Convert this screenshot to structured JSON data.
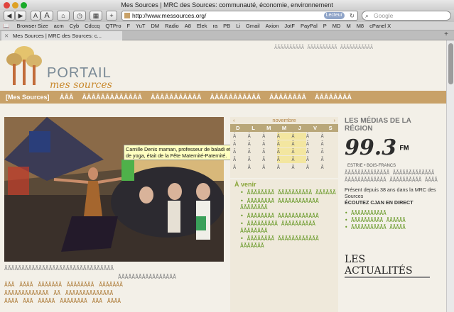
{
  "window": {
    "title": "Mes Sources | MRC des Sources: communauté, économie, environnement"
  },
  "toolbar": {
    "url": "http://www.messources.org/",
    "reader": "Lecteur",
    "search_placeholder": "Google",
    "font_small": "A",
    "font_large": "A"
  },
  "bookmarks": [
    "Browser Size",
    "acm",
    "Cyb",
    "Cdccq",
    "QTPro",
    "F",
    "YuT",
    "DM",
    "Radio",
    "A8",
    "Elek",
    "ra",
    "PB",
    "Li",
    "Gmail",
    "Axion",
    "JotF",
    "PayPal",
    "P",
    "MD",
    "M",
    "M8",
    "cPanel X"
  ],
  "tab": {
    "label": "Mes Sources | MRC des Sources: c..."
  },
  "site": {
    "logo_line1": "PORTAIL",
    "logo_line2": "mes sources",
    "nav_first": "[Mes Sources]",
    "nav_items": [
      "ĀĀĀ",
      "ĀĀĀĀĀĀĀĀĀĀĀĀĀ",
      "ĀĀĀĀĀĀĀĀĀĀĀ",
      "ĀĀĀĀĀĀĀĀĀĀĀ",
      "ĀĀĀĀĀĀĀĀ",
      "ĀĀĀĀĀĀĀĀ"
    ],
    "top_links": "ĀĀĀĀĀĀĀĀĀĀ  ĀĀĀĀĀĀĀĀĀĀ  ĀĀĀĀĀĀĀĀĀĀĀ",
    "photo_caption": "Camille Denis maman, professeur de baladi et de yoga, était de la Fête Maternité-Paternité.",
    "calendar": {
      "month": "novembre",
      "prev": "‹",
      "next": "›",
      "days": [
        "D",
        "L",
        "M",
        "M",
        "J",
        "V",
        "S"
      ]
    },
    "avenir_title": "À venir",
    "right_title": "LES MÉDIAS DE LA RÉGION",
    "radio_freq": "99.3",
    "radio_fm": "FM",
    "radio_sub": "ESTRIE • BOIS-FRANCS",
    "radio_text": "Présent depuis 38 ans dans la MRC des Sources",
    "radio_cta": "ÉCOUTEZ CJAN EN DIRECT",
    "actualites": "LES ACTUALITÉS"
  },
  "colors": {
    "accent": "#c8a168",
    "green": "#6a9a2a",
    "page_bg": "#f3f0e8"
  }
}
